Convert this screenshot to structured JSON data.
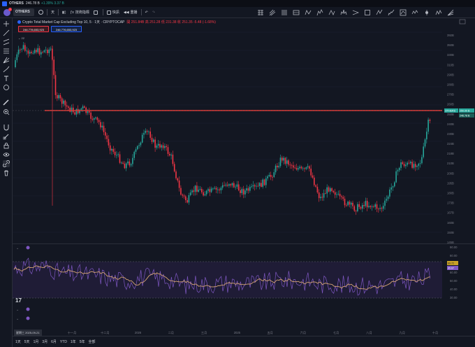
{
  "titlebar": {
    "symbol": "OTHERS",
    "price": "246.78 B",
    "change": "+1.39% 3.37 B"
  },
  "toolbar": {
    "symbol": "OTHERS",
    "interval": "天",
    "indicators_label": "技術指標",
    "replay_label": "快訊",
    "alert_label": "重播"
  },
  "chart": {
    "title": "Crypto Total Market Cap Excluding Top 10, 5 · 1天 · CRYPTOCAP",
    "ohlc": "開 251.84B 高 251.28 低 231.38 收 251.35 -5.48 (-1.68%)",
    "sell_tag": "246.778,653,923",
    "sell_sub": "賣出",
    "buy_tag": "246.776,653,923",
    "buy_sub": "買入",
    "volume_label": "22",
    "symbol_tag": "OTHERS",
    "price_tag": "250.00 B",
    "price_tag2": "246.78 B",
    "resistance_level": 250.8,
    "y_ticks": [
      "392B",
      "350B",
      "330B",
      "310B",
      "290B",
      "280B",
      "270B",
      "260B",
      "250B",
      "240B",
      "230B",
      "224B",
      "218B",
      "210B",
      "200B",
      "195B",
      "180B",
      "173B",
      "167B",
      "160B",
      "150B",
      "145B"
    ],
    "x_ticks": [
      "十一月",
      "十二月",
      "2026",
      "二月",
      "三月",
      "2025",
      "五月",
      "六月",
      "七月",
      "八月",
      "九月",
      "十月"
    ]
  },
  "oscillator": {
    "y_ticks": [
      "90.00",
      "80.00",
      "70.00",
      "60.00",
      "50.00",
      "40.00",
      "30.00"
    ],
    "tag1": "69.72",
    "tag2": "65.67"
  },
  "bottom": {
    "date_badge": "星期三 2025-09-21",
    "ranges": [
      "1天",
      "5天",
      "1月",
      "3月",
      "6月",
      "YTD",
      "1年",
      "5年",
      "全部"
    ]
  },
  "colors": {
    "up": "#26a69a",
    "down": "#f23645",
    "line": "#e53935",
    "rsi": "#7e57c2",
    "ma": "#d4a373",
    "band": "#2a2147"
  }
}
